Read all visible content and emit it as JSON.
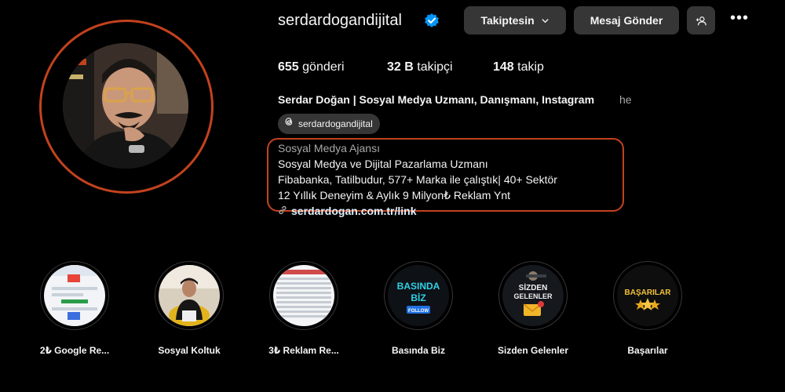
{
  "profile": {
    "username": "serdardogandijital",
    "verified": true,
    "buttons": {
      "following": "Takiptesin",
      "message": "Mesaj Gönder",
      "add_person": "+",
      "more": "•••"
    },
    "stats": {
      "posts_count": "655",
      "posts_label": "gönderi",
      "followers_count": "32 B",
      "followers_label": "takipçi",
      "following_count": "148",
      "following_label": "takip"
    },
    "full_name": "Serdar Doğan | Sosyal Medya Uzmanı, Danışmanı, Instagram",
    "pronoun": "he",
    "threads_handle": "serdardogandijital",
    "category": "Sosyal Medya Ajansı",
    "bio_lines": [
      "Sosyal Medya ve Dijital Pazarlama Uzmanı",
      "Fibabanka, Tatilbudur, 577+ Marka ile çalıştık| 40+ Sektör",
      "12 Yıllık Deneyim & Aylık 9 Milyon₺ Reklam Ynt"
    ],
    "link": "serdardogan.com.tr/link"
  },
  "highlights": [
    {
      "label": "2₺ Google Re...",
      "icon": "google-ads-screenshot"
    },
    {
      "label": "Sosyal Koltuk",
      "icon": "person-in-chair-photo"
    },
    {
      "label": "3₺ Reklam Re...",
      "icon": "ad-report-screenshot"
    },
    {
      "label": "Basında Biz",
      "icon": "press-badge",
      "text": [
        "BASINDA",
        "BİZ"
      ],
      "badge": "FOLLOW"
    },
    {
      "label": "Sizden Gelenler",
      "icon": "mail-badge",
      "text": [
        "SİZDEN",
        "GELENLER"
      ]
    },
    {
      "label": "Başarılar",
      "icon": "stars-badge",
      "text": [
        "BAŞARILAR"
      ]
    }
  ],
  "colors": {
    "accent": "#c2421e",
    "button_bg": "#363636",
    "verified": "#0095f6"
  }
}
